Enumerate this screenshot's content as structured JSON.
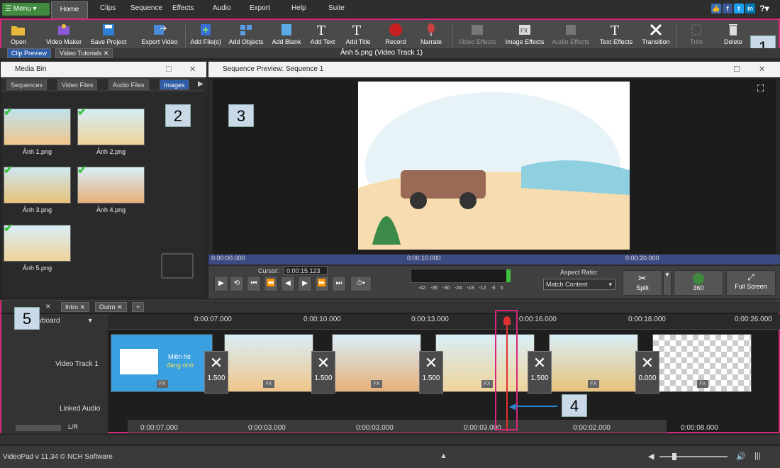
{
  "menubar": {
    "menu": "Menu",
    "items": [
      "Home",
      "Clips",
      "Sequence",
      "Effects",
      "Audio",
      "Export",
      "Help",
      "Suite"
    ]
  },
  "toolbar": {
    "buttons": [
      {
        "label": "Open",
        "icon": "folder-open-icon"
      },
      {
        "label": "Video Maker",
        "icon": "video-maker-icon"
      },
      {
        "label": "Save Project",
        "icon": "save-icon"
      },
      {
        "label": "Export Video",
        "icon": "export-icon"
      },
      {
        "label": "Add File(s)",
        "icon": "add-file-icon"
      },
      {
        "label": "Add Objects",
        "icon": "add-objects-icon"
      },
      {
        "label": "Add Blank",
        "icon": "add-blank-icon"
      },
      {
        "label": "Add Text",
        "icon": "add-text-icon"
      },
      {
        "label": "Add Title",
        "icon": "add-title-icon"
      },
      {
        "label": "Record",
        "icon": "record-icon"
      },
      {
        "label": "Narrate",
        "icon": "microphone-icon"
      },
      {
        "label": "Video Effects",
        "icon": "video-effects-icon"
      },
      {
        "label": "Image Effects",
        "icon": "image-effects-icon"
      },
      {
        "label": "Audio Effects",
        "icon": "audio-effects-icon"
      },
      {
        "label": "Text Effects",
        "icon": "text-effects-icon"
      },
      {
        "label": "Transition",
        "icon": "transition-icon"
      },
      {
        "label": "Trim",
        "icon": "trim-icon"
      },
      {
        "label": "Delete",
        "icon": "trash-icon"
      }
    ],
    "clip_tabs": [
      "Clip Preview",
      "Video Tutorials"
    ],
    "current_clip": "Ảnh 5.png (Video Track 1)"
  },
  "mediabin": {
    "title": "Media Bin",
    "tabs": [
      "Sequences",
      "Video Files",
      "Audio Files",
      "Images"
    ],
    "items": [
      "Ảnh 1.png",
      "Ảnh 2.png",
      "Ảnh 3.png",
      "Ảnh 4.png",
      "Ảnh 5.png"
    ]
  },
  "preview": {
    "title": "Sequence Preview: Sequence 1",
    "ticks": [
      "0:00:00.000",
      "0:00:10.000",
      "0:00:20.000"
    ],
    "cursor_label": "Cursor:",
    "cursor_value": "0:00:15.123",
    "meter_labels": [
      "-42",
      "-36",
      "-30",
      "-24",
      "-18",
      "-12",
      "-6",
      "0"
    ],
    "aspect_label": "Aspect Ratio:",
    "aspect_value": "Match Content",
    "split": "Split",
    "btn360": "360",
    "fullscreen": "Full Screen"
  },
  "timeline": {
    "tabs": [
      "Intro",
      "Outro",
      "+"
    ],
    "storyboard": "yboard",
    "ruler": [
      "0:00:07.000",
      "0:00:10.000",
      "0:00:13.000",
      "0:00:16.000",
      "0:00:18.000",
      "0:00:26.000"
    ],
    "video_track": "Video Track 1",
    "linked_audio": "Linked Audio",
    "lr": "L/R",
    "clip1_text": "Miền hè",
    "clip1_text2": "đáng nhớ",
    "transitions": [
      "1.500",
      "1.500",
      "1.500",
      "1.500",
      "0.000"
    ],
    "fx": "FX",
    "durations": [
      "0:00:07.000",
      "0:00:03.000",
      "0:00:03.000",
      "0:00:03.000",
      "0:00:02.000",
      "0:00:08.000"
    ]
  },
  "status": {
    "version": "VideoPad v 11.34 © NCH Software"
  },
  "badges": [
    "1",
    "2",
    "3",
    "4",
    "5"
  ]
}
